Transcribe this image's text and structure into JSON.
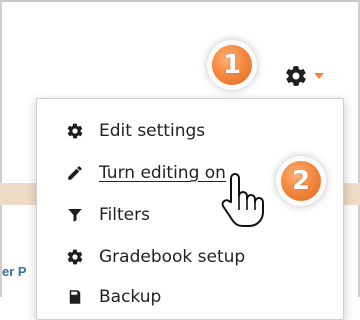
{
  "settings_menu": {
    "toggle_icon": "gear-icon",
    "items": [
      {
        "label": "Edit settings",
        "icon": "gear-icon"
      },
      {
        "label": "Turn editing on",
        "icon": "pencil-icon"
      },
      {
        "label": "Filters",
        "icon": "filter-icon"
      },
      {
        "label": "Gradebook setup",
        "icon": "gear-icon"
      },
      {
        "label": "Backup",
        "icon": "backup-icon"
      }
    ]
  },
  "callouts": [
    {
      "number": "1"
    },
    {
      "number": "2"
    }
  ],
  "page": {
    "partial_text": "er P"
  },
  "colors": {
    "badge_orange": "#f58a3f",
    "caret_orange": "#f0883c",
    "band": "#eedcc6",
    "link_blue": "#3a6ea5"
  }
}
